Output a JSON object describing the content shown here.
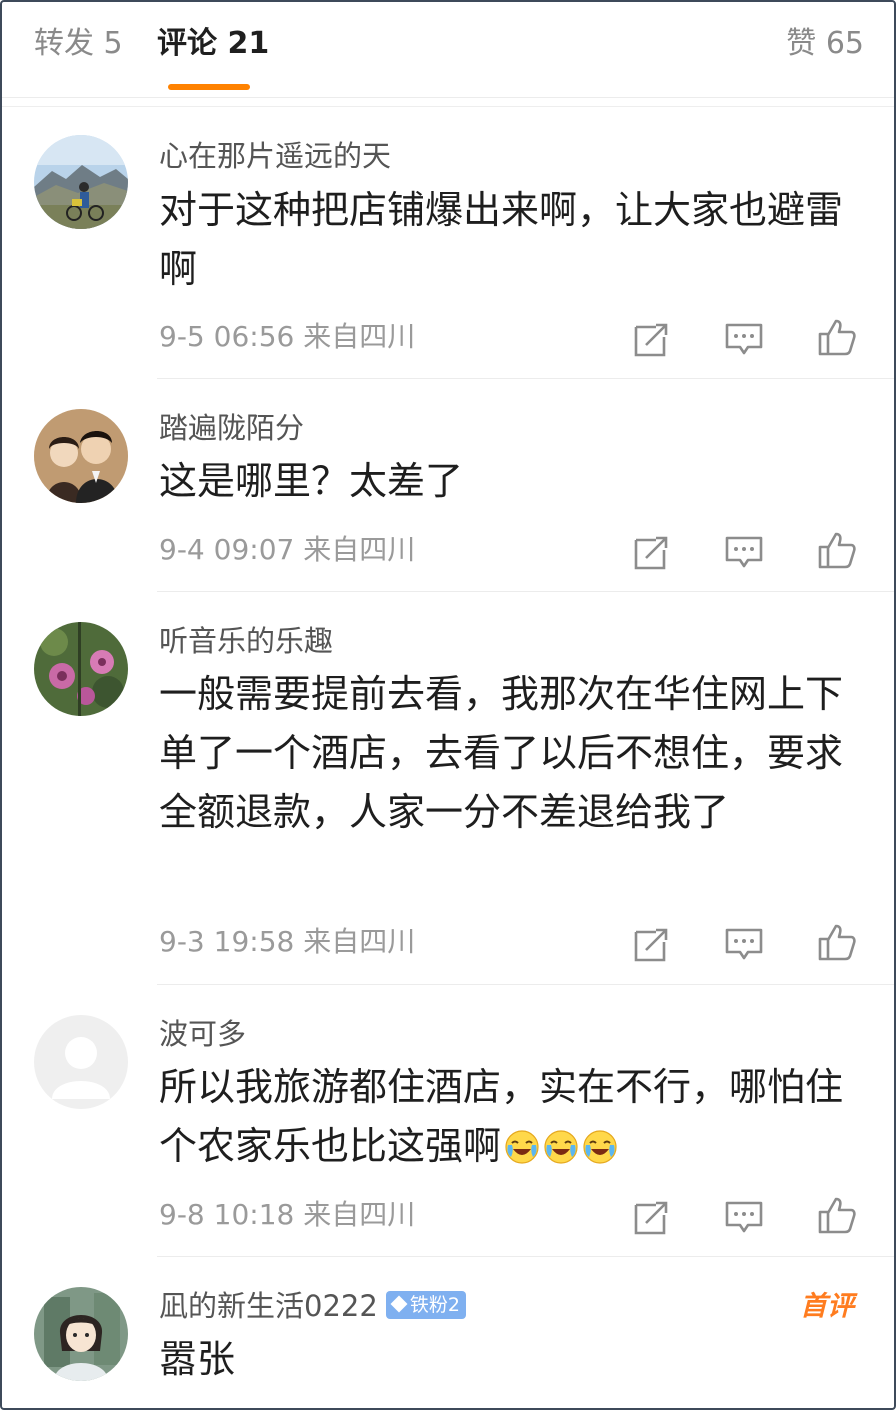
{
  "tabs": {
    "repost": "转发 5",
    "comments": "评论 21",
    "likes": "赞 65"
  },
  "comments": [
    {
      "name": "心在那片遥远的天",
      "text": "对于这种把店铺爆出来啊，让大家也避雷啊",
      "time": "9-5 06:56",
      "location": "来自四川",
      "avatar": "landscape-cyclist"
    },
    {
      "name": "踏遍陇陌分",
      "text": "这是哪里？太差了",
      "time": "9-4 09:07",
      "location": "来自四川",
      "avatar": "vintage-couple-photo"
    },
    {
      "name": "听音乐的乐趣",
      "text": "一般需要提前去看，我那次在华住网上下单了一个酒店，去看了以后不想住，要求全额退款，人家一分不差退给我了",
      "time": "9-3 19:58",
      "location": "来自四川",
      "avatar": "flowers"
    },
    {
      "name": "波可多",
      "text": "所以我旅游都住酒店，实在不行，哪怕住个农家乐也比这强啊",
      "emojis": [
        "laugh-cry-emoji",
        "laugh-cry-emoji",
        "laugh-cry-emoji"
      ],
      "time": "9-8 10:18",
      "location": "来自四川",
      "avatar": "default-avatar"
    },
    {
      "name": "凪的新生活0222",
      "badge": "铁粉2",
      "tag": "首评",
      "text": "嚣张",
      "avatar": "anime-girl"
    }
  ],
  "icons": {
    "share": "share-icon",
    "reply": "comment-icon",
    "like": "thumbs-up-icon"
  },
  "colors": {
    "accent": "#ff8200",
    "fan_badge": "#7fb0f0",
    "first_review": "#ff7c1f"
  }
}
